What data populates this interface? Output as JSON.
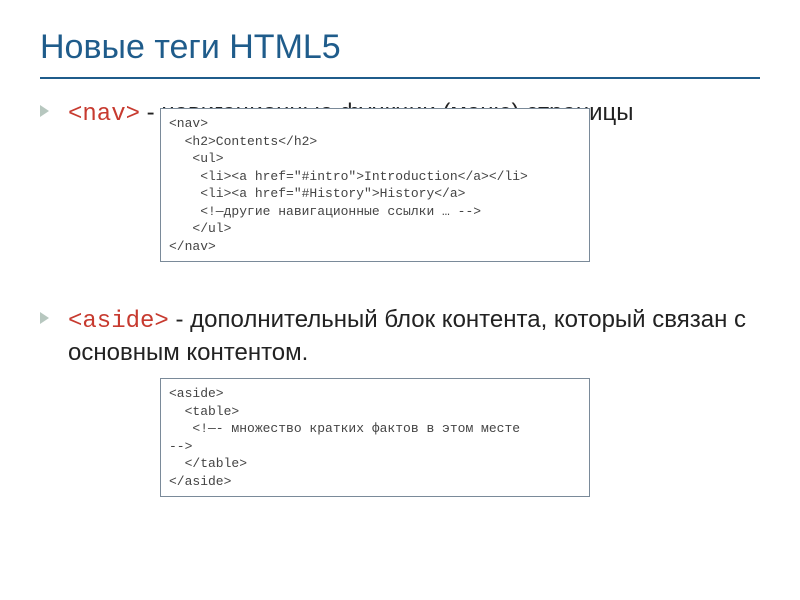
{
  "title": "Новые теги HTML5",
  "item1": {
    "tag": "<nav>",
    "desc": " - навигационные функции (меню) страницы",
    "code": "<nav>\n  <h2>Contents</h2>\n   <ul>\n    <li><a href=\"#intro\">Introduction</a></li>\n    <li><a href=\"#History\">History</a>\n    <!—другие навигационные ссылки … -->\n   </ul>\n</nav>"
  },
  "item2": {
    "tag": "<aside>",
    "desc": " - дополнительный блок контента, который связан с основным контентом.",
    "code": "<aside>\n  <table>\n   <!—- множество кратких фактов в этом месте\n-->\n  </table>\n</aside>"
  }
}
